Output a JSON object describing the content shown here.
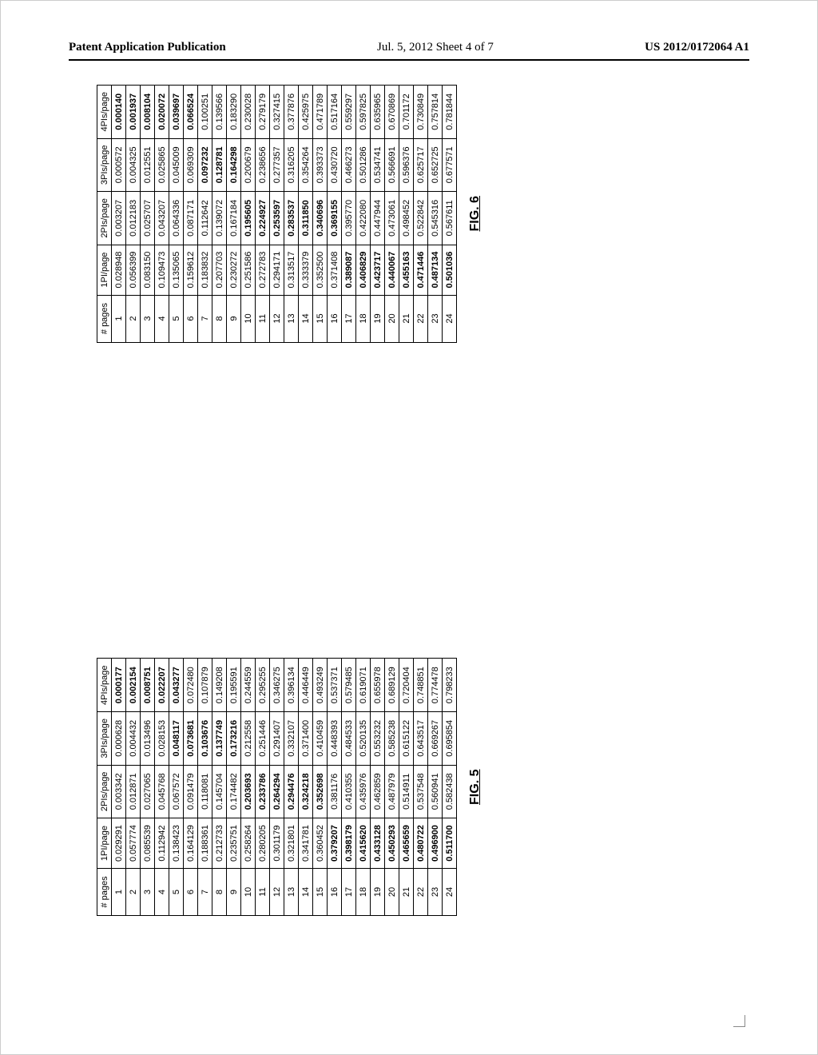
{
  "header": {
    "left": "Patent Application Publication",
    "center": "Jul. 5, 2012  Sheet 4 of 7",
    "right": "US 2012/0172064 A1"
  },
  "figures": [
    {
      "label": "FIG. 5",
      "columns": [
        "# pages",
        "1PI/page",
        "2PIs/page",
        "3PIs/page",
        "4PIs/page"
      ],
      "rows": [
        {
          "n": "1",
          "c1": "0.029291",
          "c2": "0.003342",
          "c3": "0.000628",
          "c4": "0.000177",
          "b": [
            false,
            false,
            false,
            true
          ]
        },
        {
          "n": "2",
          "c1": "0.057774",
          "c2": "0.012871",
          "c3": "0.004432",
          "c4": "0.002154",
          "b": [
            false,
            false,
            false,
            true
          ]
        },
        {
          "n": "3",
          "c1": "0.085539",
          "c2": "0.027065",
          "c3": "0.013496",
          "c4": "0.008751",
          "b": [
            false,
            false,
            false,
            true
          ]
        },
        {
          "n": "4",
          "c1": "0.112942",
          "c2": "0.045768",
          "c3": "0.028153",
          "c4": "0.022207",
          "b": [
            false,
            false,
            false,
            true
          ]
        },
        {
          "n": "5",
          "c1": "0.138423",
          "c2": "0.067572",
          "c3": "0.048117",
          "c4": "0.043277",
          "b": [
            false,
            false,
            true,
            true
          ]
        },
        {
          "n": "6",
          "c1": "0.164129",
          "c2": "0.091479",
          "c3": "0.073681",
          "c4": "0.072480",
          "b": [
            false,
            false,
            true,
            false
          ]
        },
        {
          "n": "7",
          "c1": "0.188361",
          "c2": "0.118081",
          "c3": "0.103676",
          "c4": "0.107879",
          "b": [
            false,
            false,
            true,
            false
          ]
        },
        {
          "n": "8",
          "c1": "0.212733",
          "c2": "0.145704",
          "c3": "0.137749",
          "c4": "0.149208",
          "b": [
            false,
            false,
            true,
            false
          ]
        },
        {
          "n": "9",
          "c1": "0.235751",
          "c2": "0.174482",
          "c3": "0.173216",
          "c4": "0.195591",
          "b": [
            false,
            false,
            true,
            false
          ]
        },
        {
          "n": "10",
          "c1": "0.258264",
          "c2": "0.203693",
          "c3": "0.212558",
          "c4": "0.244559",
          "b": [
            false,
            true,
            false,
            false
          ]
        },
        {
          "n": "11",
          "c1": "0.280205",
          "c2": "0.233786",
          "c3": "0.251446",
          "c4": "0.295255",
          "b": [
            false,
            true,
            false,
            false
          ]
        },
        {
          "n": "12",
          "c1": "0.301179",
          "c2": "0.264294",
          "c3": "0.291407",
          "c4": "0.346275",
          "b": [
            false,
            true,
            false,
            false
          ]
        },
        {
          "n": "13",
          "c1": "0.321801",
          "c2": "0.294476",
          "c3": "0.332107",
          "c4": "0.396134",
          "b": [
            false,
            true,
            false,
            false
          ]
        },
        {
          "n": "14",
          "c1": "0.341781",
          "c2": "0.324218",
          "c3": "0.371400",
          "c4": "0.446449",
          "b": [
            false,
            true,
            false,
            false
          ]
        },
        {
          "n": "15",
          "c1": "0.360452",
          "c2": "0.352698",
          "c3": "0.410459",
          "c4": "0.493249",
          "b": [
            false,
            true,
            false,
            false
          ]
        },
        {
          "n": "16",
          "c1": "0.379207",
          "c2": "0.381176",
          "c3": "0.448393",
          "c4": "0.537371",
          "b": [
            true,
            false,
            false,
            false
          ]
        },
        {
          "n": "17",
          "c1": "0.398179",
          "c2": "0.410355",
          "c3": "0.484533",
          "c4": "0.579485",
          "b": [
            true,
            false,
            false,
            false
          ]
        },
        {
          "n": "18",
          "c1": "0.415620",
          "c2": "0.435976",
          "c3": "0.520135",
          "c4": "0.619071",
          "b": [
            true,
            false,
            false,
            false
          ]
        },
        {
          "n": "19",
          "c1": "0.433128",
          "c2": "0.462859",
          "c3": "0.553232",
          "c4": "0.655978",
          "b": [
            true,
            false,
            false,
            false
          ]
        },
        {
          "n": "20",
          "c1": "0.450293",
          "c2": "0.487979",
          "c3": "0.585238",
          "c4": "0.689129",
          "b": [
            true,
            false,
            false,
            false
          ]
        },
        {
          "n": "21",
          "c1": "0.465659",
          "c2": "0.514911",
          "c3": "0.615122",
          "c4": "0.720404",
          "b": [
            true,
            false,
            false,
            false
          ]
        },
        {
          "n": "22",
          "c1": "0.480722",
          "c2": "0.537548",
          "c3": "0.643517",
          "c4": "0.748851",
          "b": [
            true,
            false,
            false,
            false
          ]
        },
        {
          "n": "23",
          "c1": "0.496900",
          "c2": "0.560941",
          "c3": "0.669267",
          "c4": "0.774478",
          "b": [
            true,
            false,
            false,
            false
          ]
        },
        {
          "n": "24",
          "c1": "0.511700",
          "c2": "0.582438",
          "c3": "0.695854",
          "c4": "0.798233",
          "b": [
            true,
            false,
            false,
            false
          ]
        }
      ]
    },
    {
      "label": "FIG. 6",
      "columns": [
        "# pages",
        "1PI/page",
        "2PIs/page",
        "3PIs/page",
        "4PIs/page"
      ],
      "rows": [
        {
          "n": "1",
          "c1": "0.028948",
          "c2": "0.003207",
          "c3": "0.000572",
          "c4": "0.000140",
          "b": [
            false,
            false,
            false,
            true
          ]
        },
        {
          "n": "2",
          "c1": "0.056399",
          "c2": "0.012183",
          "c3": "0.004325",
          "c4": "0.001937",
          "b": [
            false,
            false,
            false,
            true
          ]
        },
        {
          "n": "3",
          "c1": "0.083150",
          "c2": "0.025707",
          "c3": "0.012551",
          "c4": "0.008104",
          "b": [
            false,
            false,
            false,
            true
          ]
        },
        {
          "n": "4",
          "c1": "0.109473",
          "c2": "0.043207",
          "c3": "0.025865",
          "c4": "0.020072",
          "b": [
            false,
            false,
            false,
            true
          ]
        },
        {
          "n": "5",
          "c1": "0.135065",
          "c2": "0.064336",
          "c3": "0.045009",
          "c4": "0.039697",
          "b": [
            false,
            false,
            false,
            true
          ]
        },
        {
          "n": "6",
          "c1": "0.159612",
          "c2": "0.087171",
          "c3": "0.069309",
          "c4": "0.066524",
          "b": [
            false,
            false,
            false,
            true
          ]
        },
        {
          "n": "7",
          "c1": "0.183832",
          "c2": "0.112642",
          "c3": "0.097232",
          "c4": "0.100251",
          "b": [
            false,
            false,
            true,
            false
          ]
        },
        {
          "n": "8",
          "c1": "0.207703",
          "c2": "0.139072",
          "c3": "0.128781",
          "c4": "0.139566",
          "b": [
            false,
            false,
            true,
            false
          ]
        },
        {
          "n": "9",
          "c1": "0.230272",
          "c2": "0.167184",
          "c3": "0.164298",
          "c4": "0.183290",
          "b": [
            false,
            false,
            true,
            false
          ]
        },
        {
          "n": "10",
          "c1": "0.251586",
          "c2": "0.195605",
          "c3": "0.200679",
          "c4": "0.230028",
          "b": [
            false,
            true,
            false,
            false
          ]
        },
        {
          "n": "11",
          "c1": "0.272783",
          "c2": "0.224927",
          "c3": "0.238656",
          "c4": "0.279179",
          "b": [
            false,
            true,
            false,
            false
          ]
        },
        {
          "n": "12",
          "c1": "0.294171",
          "c2": "0.253597",
          "c3": "0.277357",
          "c4": "0.327415",
          "b": [
            false,
            true,
            false,
            false
          ]
        },
        {
          "n": "13",
          "c1": "0.313517",
          "c2": "0.283537",
          "c3": "0.316205",
          "c4": "0.377876",
          "b": [
            false,
            true,
            false,
            false
          ]
        },
        {
          "n": "14",
          "c1": "0.333379",
          "c2": "0.311850",
          "c3": "0.354264",
          "c4": "0.425975",
          "b": [
            false,
            true,
            false,
            false
          ]
        },
        {
          "n": "15",
          "c1": "0.352500",
          "c2": "0.340696",
          "c3": "0.393373",
          "c4": "0.471789",
          "b": [
            false,
            true,
            false,
            false
          ]
        },
        {
          "n": "16",
          "c1": "0.371408",
          "c2": "0.369155",
          "c3": "0.430720",
          "c4": "0.517164",
          "b": [
            false,
            true,
            false,
            false
          ]
        },
        {
          "n": "17",
          "c1": "0.389087",
          "c2": "0.395770",
          "c3": "0.466273",
          "c4": "0.559297",
          "b": [
            true,
            false,
            false,
            false
          ]
        },
        {
          "n": "18",
          "c1": "0.406829",
          "c2": "0.422080",
          "c3": "0.501286",
          "c4": "0.597825",
          "b": [
            true,
            false,
            false,
            false
          ]
        },
        {
          "n": "19",
          "c1": "0.423717",
          "c2": "0.447944",
          "c3": "0.534741",
          "c4": "0.635965",
          "b": [
            true,
            false,
            false,
            false
          ]
        },
        {
          "n": "20",
          "c1": "0.440067",
          "c2": "0.473061",
          "c3": "0.566691",
          "c4": "0.670869",
          "b": [
            true,
            false,
            false,
            false
          ]
        },
        {
          "n": "21",
          "c1": "0.455163",
          "c2": "0.498452",
          "c3": "0.596376",
          "c4": "0.701172",
          "b": [
            true,
            false,
            false,
            false
          ]
        },
        {
          "n": "22",
          "c1": "0.471446",
          "c2": "0.522842",
          "c3": "0.625717",
          "c4": "0.730849",
          "b": [
            true,
            false,
            false,
            false
          ]
        },
        {
          "n": "23",
          "c1": "0.487134",
          "c2": "0.545316",
          "c3": "0.652725",
          "c4": "0.757814",
          "b": [
            true,
            false,
            false,
            false
          ]
        },
        {
          "n": "24",
          "c1": "0.501036",
          "c2": "0.567611",
          "c3": "0.677571",
          "c4": "0.781844",
          "b": [
            true,
            false,
            false,
            false
          ]
        }
      ]
    }
  ],
  "chart_data": [
    {
      "type": "table",
      "title": "FIG. 5",
      "columns": [
        "# pages",
        "1PI/page",
        "2PIs/page",
        "3PIs/page",
        "4PIs/page"
      ],
      "x": [
        1,
        2,
        3,
        4,
        5,
        6,
        7,
        8,
        9,
        10,
        11,
        12,
        13,
        14,
        15,
        16,
        17,
        18,
        19,
        20,
        21,
        22,
        23,
        24
      ],
      "series": [
        {
          "name": "1PI/page",
          "values": [
            0.029291,
            0.057774,
            0.085539,
            0.112942,
            0.138423,
            0.164129,
            0.188361,
            0.212733,
            0.235751,
            0.258264,
            0.280205,
            0.301179,
            0.321801,
            0.341781,
            0.360452,
            0.379207,
            0.398179,
            0.41562,
            0.433128,
            0.450293,
            0.465659,
            0.480722,
            0.4969,
            0.5117
          ]
        },
        {
          "name": "2PIs/page",
          "values": [
            0.003342,
            0.012871,
            0.027065,
            0.045768,
            0.067572,
            0.091479,
            0.118081,
            0.145704,
            0.174482,
            0.203693,
            0.233786,
            0.264294,
            0.294476,
            0.324218,
            0.352698,
            0.381176,
            0.410355,
            0.435976,
            0.462859,
            0.487979,
            0.514911,
            0.537548,
            0.560941,
            0.582438
          ]
        },
        {
          "name": "3PIs/page",
          "values": [
            0.000628,
            0.004432,
            0.013496,
            0.028153,
            0.048117,
            0.073681,
            0.103676,
            0.137749,
            0.173216,
            0.212558,
            0.251446,
            0.291407,
            0.332107,
            0.3714,
            0.410459,
            0.448393,
            0.484533,
            0.520135,
            0.553232,
            0.585238,
            0.615122,
            0.643517,
            0.669267,
            0.695854
          ]
        },
        {
          "name": "4PIs/page",
          "values": [
            0.000177,
            0.002154,
            0.008751,
            0.022207,
            0.043277,
            0.07248,
            0.107879,
            0.149208,
            0.195591,
            0.244559,
            0.295255,
            0.346275,
            0.396134,
            0.446449,
            0.493249,
            0.537371,
            0.579485,
            0.619071,
            0.655978,
            0.689129,
            0.720404,
            0.748851,
            0.774478,
            0.798233
          ]
        }
      ]
    },
    {
      "type": "table",
      "title": "FIG. 6",
      "columns": [
        "# pages",
        "1PI/page",
        "2PIs/page",
        "3PIs/page",
        "4PIs/page"
      ],
      "x": [
        1,
        2,
        3,
        4,
        5,
        6,
        7,
        8,
        9,
        10,
        11,
        12,
        13,
        14,
        15,
        16,
        17,
        18,
        19,
        20,
        21,
        22,
        23,
        24
      ],
      "series": [
        {
          "name": "1PI/page",
          "values": [
            0.028948,
            0.056399,
            0.08315,
            0.109473,
            0.135065,
            0.159612,
            0.183832,
            0.207703,
            0.230272,
            0.251586,
            0.272783,
            0.294171,
            0.313517,
            0.333379,
            0.3525,
            0.371408,
            0.389087,
            0.406829,
            0.423717,
            0.440067,
            0.455163,
            0.471446,
            0.487134,
            0.501036
          ]
        },
        {
          "name": "2PIs/page",
          "values": [
            0.003207,
            0.012183,
            0.025707,
            0.043207,
            0.064336,
            0.087171,
            0.112642,
            0.139072,
            0.167184,
            0.195605,
            0.224927,
            0.253597,
            0.283537,
            0.31185,
            0.340696,
            0.369155,
            0.39577,
            0.42208,
            0.447944,
            0.473061,
            0.498452,
            0.522842,
            0.545316,
            0.567611
          ]
        },
        {
          "name": "3PIs/page",
          "values": [
            0.000572,
            0.004325,
            0.012551,
            0.025865,
            0.045009,
            0.069309,
            0.097232,
            0.128781,
            0.164298,
            0.200679,
            0.238656,
            0.277357,
            0.316205,
            0.354264,
            0.393373,
            0.43072,
            0.466273,
            0.501286,
            0.534741,
            0.566691,
            0.596376,
            0.625717,
            0.652725,
            0.677571
          ]
        },
        {
          "name": "4PIs/page",
          "values": [
            0.00014,
            0.001937,
            0.008104,
            0.020072,
            0.039697,
            0.066524,
            0.100251,
            0.139566,
            0.18329,
            0.230028,
            0.279179,
            0.327415,
            0.377876,
            0.425975,
            0.471789,
            0.517164,
            0.559297,
            0.597825,
            0.635965,
            0.670869,
            0.701172,
            0.730849,
            0.757814,
            0.781844
          ]
        }
      ]
    }
  ]
}
